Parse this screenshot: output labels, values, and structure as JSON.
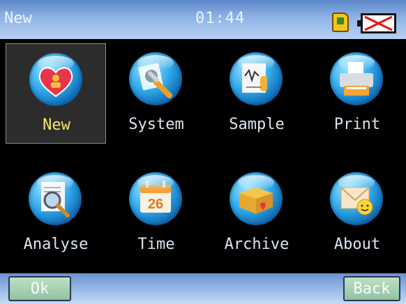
{
  "header": {
    "title": "New",
    "clock": "01:44"
  },
  "status": {
    "sd_card": "sd-card-icon",
    "battery": "battery-empty-icon"
  },
  "menu": [
    {
      "label": "New",
      "icon": "heart-profile-icon",
      "selected": true
    },
    {
      "label": "System",
      "icon": "wrench-settings-icon",
      "selected": false
    },
    {
      "label": "Sample",
      "icon": "sample-document-icon",
      "selected": false
    },
    {
      "label": "Print",
      "icon": "printer-icon",
      "selected": false
    },
    {
      "label": "Analyse",
      "icon": "magnifier-document-icon",
      "selected": false
    },
    {
      "label": "Time",
      "icon": "calendar-icon",
      "selected": false
    },
    {
      "label": "Archive",
      "icon": "archive-box-icon",
      "selected": false
    },
    {
      "label": "About",
      "icon": "envelope-smiley-icon",
      "selected": false
    }
  ],
  "calendar_day": "26",
  "footer": {
    "ok_label": "Ok",
    "back_label": "Back"
  },
  "colors": {
    "header_bg": "#7fa6dc",
    "selected_label": "#f6e76a",
    "orb": "#2ea8e8"
  }
}
